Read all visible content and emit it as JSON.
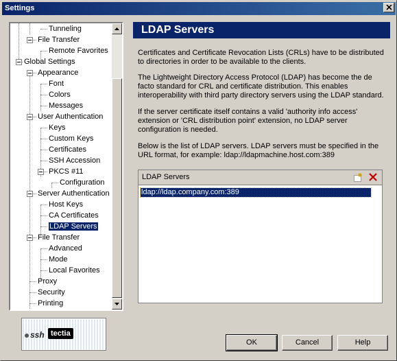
{
  "window": {
    "title": "Settings"
  },
  "tree": {
    "items": [
      {
        "label": "Tunneling",
        "level": 2
      },
      {
        "label": "File Transfer",
        "level": 1,
        "expanded": true
      },
      {
        "label": "Remote Favorites",
        "level": 2
      },
      {
        "label": "Global Settings",
        "level": 0,
        "expanded": true
      },
      {
        "label": "Appearance",
        "level": 1,
        "expanded": true
      },
      {
        "label": "Font",
        "level": 2
      },
      {
        "label": "Colors",
        "level": 2
      },
      {
        "label": "Messages",
        "level": 2
      },
      {
        "label": "User Authentication",
        "level": 1,
        "expanded": true
      },
      {
        "label": "Keys",
        "level": 2
      },
      {
        "label": "Custom Keys",
        "level": 2
      },
      {
        "label": "Certificates",
        "level": 2
      },
      {
        "label": "SSH Accession",
        "level": 2
      },
      {
        "label": "PKCS #11",
        "level": 2,
        "expanded": true
      },
      {
        "label": "Configuration",
        "level": 3
      },
      {
        "label": "Server Authentication",
        "level": 1,
        "expanded": true
      },
      {
        "label": "Host Keys",
        "level": 2
      },
      {
        "label": "CA Certificates",
        "level": 2
      },
      {
        "label": "LDAP Servers",
        "level": 2,
        "selected": true
      },
      {
        "label": "File Transfer",
        "level": 1,
        "expanded": true
      },
      {
        "label": "Advanced",
        "level": 2
      },
      {
        "label": "Mode",
        "level": 2
      },
      {
        "label": "Local Favorites",
        "level": 2
      },
      {
        "label": "Proxy",
        "level": 1
      },
      {
        "label": "Security",
        "level": 1
      },
      {
        "label": "Printing",
        "level": 1
      }
    ]
  },
  "logo": {
    "ssh": "ssh",
    "product": "tectia"
  },
  "page": {
    "title": "LDAP Servers",
    "paragraphs": [
      "Certificates and Certificate Revocation Lists (CRLs) have to be distributed to directories in order to be available to the clients.",
      "The Lightweight Directory Access Protocol (LDAP) has become the de facto standard for CRL and certificate distribution. This enables interoperability with third party directory servers using the LDAP standard.",
      "If the server certificate itself contains a valid 'authority info access' extension or 'CRL distribution point' extension, no LDAP server configuration is needed.",
      "Below is the list of LDAP servers. LDAP servers must be specified in the URL format, for example: ldap://ldapmachine.host.com:389"
    ]
  },
  "ldap_list": {
    "header": "LDAP Servers",
    "items": [
      "ldap://ldap.company.com:389"
    ]
  },
  "buttons": {
    "ok": "OK",
    "cancel": "Cancel",
    "help": "Help"
  },
  "colors": {
    "titlebar": "#0a246a",
    "selection": "#0a246a",
    "delete": "#c00000"
  }
}
